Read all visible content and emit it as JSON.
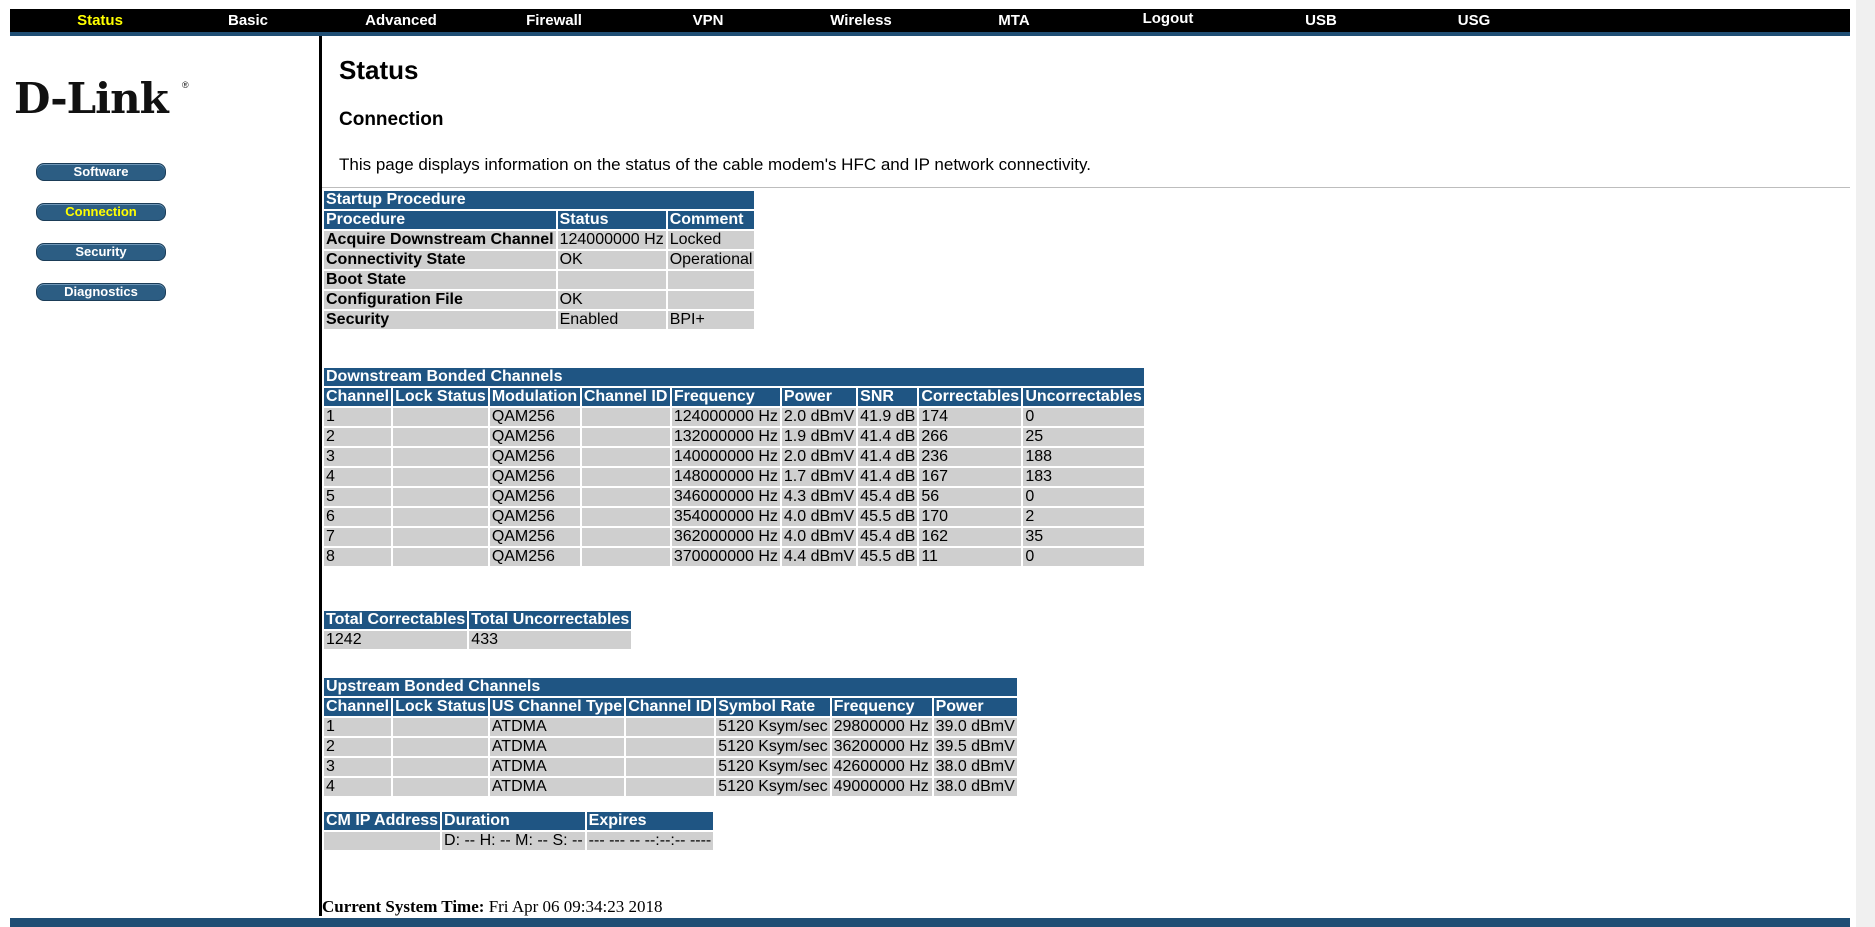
{
  "nav": {
    "items": [
      {
        "label": "Status",
        "active": true
      },
      {
        "label": "Basic"
      },
      {
        "label": "Advanced"
      },
      {
        "label": "Firewall"
      },
      {
        "label": "VPN"
      },
      {
        "label": "Wireless"
      },
      {
        "label": "MTA"
      },
      {
        "label": "Logout"
      },
      {
        "label": "USB"
      },
      {
        "label": "USG"
      }
    ]
  },
  "brand": {
    "logo_text": "D-Link",
    "registered": "®"
  },
  "sidebar": {
    "items": [
      {
        "label": "Software"
      },
      {
        "label": "Connection",
        "active": true
      },
      {
        "label": "Security"
      },
      {
        "label": "Diagnostics"
      }
    ]
  },
  "main": {
    "title": "Status",
    "section": "Connection",
    "description": "This page displays information on the status of the cable modem's HFC and IP network connectivity."
  },
  "startup": {
    "title": "Startup Procedure",
    "headers": [
      "Procedure",
      "Status",
      "Comment"
    ],
    "rows": [
      [
        "Acquire Downstream Channel",
        "124000000 Hz",
        "Locked"
      ],
      [
        "Connectivity State",
        "OK",
        "Operational"
      ],
      [
        "Boot State",
        "",
        ""
      ],
      [
        "Configuration File",
        "OK",
        ""
      ],
      [
        "Security",
        "Enabled",
        "BPI+"
      ]
    ]
  },
  "downstream": {
    "title": "Downstream Bonded Channels",
    "headers": [
      "Channel",
      "Lock Status",
      "Modulation",
      "Channel ID",
      "Frequency",
      "Power",
      "SNR",
      "Correctables",
      "Uncorrectables"
    ],
    "rows": [
      [
        "1",
        "",
        "QAM256",
        "",
        "124000000 Hz",
        "2.0 dBmV",
        "41.9 dB",
        "174",
        "0"
      ],
      [
        "2",
        "",
        "QAM256",
        "",
        "132000000 Hz",
        "1.9 dBmV",
        "41.4 dB",
        "266",
        "25"
      ],
      [
        "3",
        "",
        "QAM256",
        "",
        "140000000 Hz",
        "2.0 dBmV",
        "41.4 dB",
        "236",
        "188"
      ],
      [
        "4",
        "",
        "QAM256",
        "",
        "148000000 Hz",
        "1.7 dBmV",
        "41.4 dB",
        "167",
        "183"
      ],
      [
        "5",
        "",
        "QAM256",
        "",
        "346000000 Hz",
        "4.3 dBmV",
        "45.4 dB",
        "56",
        "0"
      ],
      [
        "6",
        "",
        "QAM256",
        "",
        "354000000 Hz",
        "4.0 dBmV",
        "45.5 dB",
        "170",
        "2"
      ],
      [
        "7",
        "",
        "QAM256",
        "",
        "362000000 Hz",
        "4.0 dBmV",
        "45.4 dB",
        "162",
        "35"
      ],
      [
        "8",
        "",
        "QAM256",
        "",
        "370000000 Hz",
        "4.4 dBmV",
        "45.5 dB",
        "11",
        "0"
      ]
    ]
  },
  "totals": {
    "headers": [
      "Total Correctables",
      "Total Uncorrectables"
    ],
    "values": [
      "1242",
      "433"
    ]
  },
  "upstream": {
    "title": "Upstream Bonded Channels",
    "headers": [
      "Channel",
      "Lock Status",
      "US Channel Type",
      "Channel ID",
      "Symbol Rate",
      "Frequency",
      "Power"
    ],
    "rows": [
      [
        "1",
        "",
        "ATDMA",
        "",
        "5120 Ksym/sec",
        "29800000 Hz",
        "39.0 dBmV"
      ],
      [
        "2",
        "",
        "ATDMA",
        "",
        "5120 Ksym/sec",
        "36200000 Hz",
        "39.5 dBmV"
      ],
      [
        "3",
        "",
        "ATDMA",
        "",
        "5120 Ksym/sec",
        "42600000 Hz",
        "38.0 dBmV"
      ],
      [
        "4",
        "",
        "ATDMA",
        "",
        "5120 Ksym/sec",
        "49000000 Hz",
        "38.0 dBmV"
      ]
    ]
  },
  "cmip": {
    "headers": [
      "CM IP Address",
      "Duration",
      "Expires"
    ],
    "values": [
      "",
      "D: -- H: -- M: -- S: --",
      "--- --- -- --:--:-- ----"
    ]
  },
  "footer": {
    "label": "Current System Time:",
    "time": "Fri Apr 06 09:34:23 2018"
  },
  "colors": {
    "nav_bg": "#000000",
    "accent": "#1f5583",
    "active_text": "#ffff00",
    "cell_bg": "#cfcfcf"
  }
}
